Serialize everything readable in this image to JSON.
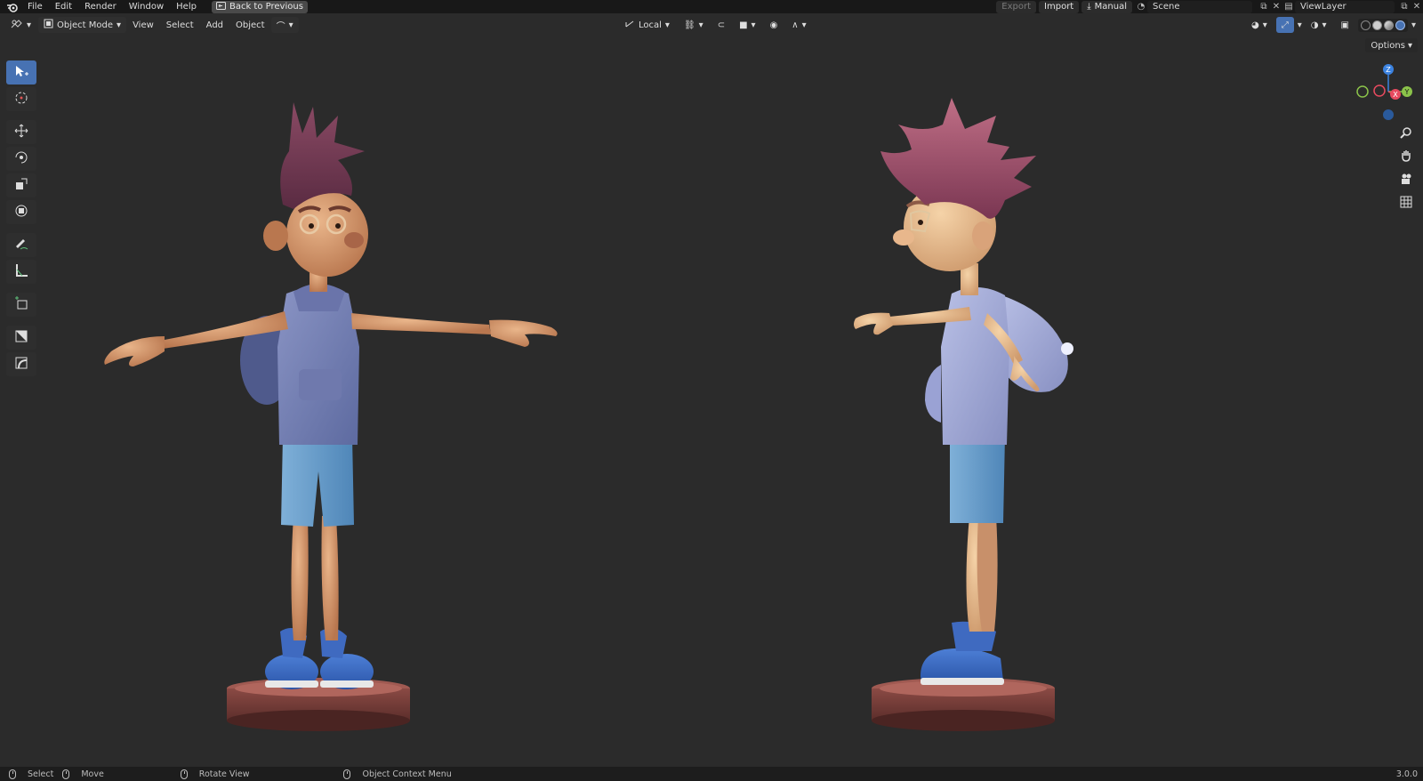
{
  "topbar": {
    "menus": [
      "File",
      "Edit",
      "Render",
      "Window",
      "Help"
    ],
    "back_label": "Back to Previous",
    "export_label": "Export",
    "import_label": "Import",
    "manual_label": "Manual",
    "scene_name": "Scene",
    "view_layer": "ViewLayer"
  },
  "viewport_header": {
    "mode": "Object Mode",
    "menus": [
      "View",
      "Select",
      "Add",
      "Object"
    ],
    "transform_orientation": "Local"
  },
  "options_label": "Options",
  "gizmo": {
    "z": "Z",
    "x": "X",
    "y": "Y"
  },
  "statusbar": {
    "select": "Select",
    "move": "Move",
    "rotate": "Rotate View",
    "context": "Object Context Menu",
    "version": "3.0.0"
  },
  "colors": {
    "accent": "#4772b3",
    "background": "#2b2b2b",
    "x_axis": "#e84a5f",
    "y_axis": "#8bc34a",
    "z_axis": "#3b82e0"
  }
}
